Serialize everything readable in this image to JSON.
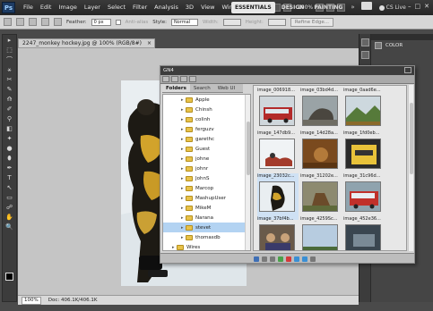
{
  "appbar": {
    "logo": "Ps",
    "menu": [
      "File",
      "Edit",
      "Image",
      "Layer",
      "Select",
      "Filter",
      "Analysis",
      "3D",
      "View",
      "Window",
      "Help"
    ],
    "zoom": "100%",
    "workspaces": [
      "ESSENTIALS",
      "DESIGN",
      "PAINTING"
    ],
    "more": "»",
    "cs_live": "CS Live",
    "window_controls": [
      "–",
      "□",
      "✕"
    ]
  },
  "options": {
    "feather_label": "Feather:",
    "feather_value": "0 px",
    "antialias_label": "Anti-alias",
    "style_label": "Style:",
    "style_value": "Normal",
    "width_label": "Width:",
    "height_label": "Height:",
    "refine_edge": "Refine Edge..."
  },
  "tools": [
    "▸",
    "⬚",
    "⌒",
    "⚹",
    "✂",
    "✎",
    "⟰",
    "✐",
    "⚲",
    "◧",
    "✦",
    "●",
    "⬮",
    "✒",
    "T",
    "↖",
    "▭",
    "☍",
    "✋",
    "🔍"
  ],
  "document": {
    "tab_title": "2247_monkey hockey.jpg @ 100% (RGB/8#)",
    "tab_close": "×",
    "status_zoom": "100%",
    "status_doc": "Doc: 406.1K/406.1K"
  },
  "right_panel": {
    "color_label": "COLOR"
  },
  "bridge": {
    "title": "GN4",
    "tabs": [
      "Folders",
      "Search",
      "Web UI"
    ],
    "folders": [
      {
        "name": "Apple",
        "indent": 2
      },
      {
        "name": "Chinsh",
        "indent": 2
      },
      {
        "name": "colinh",
        "indent": 2
      },
      {
        "name": "ferguzv",
        "indent": 2
      },
      {
        "name": "garethc",
        "indent": 2
      },
      {
        "name": "Guest",
        "indent": 2
      },
      {
        "name": "johne",
        "indent": 2
      },
      {
        "name": "johnr",
        "indent": 2
      },
      {
        "name": "JohnS",
        "indent": 2
      },
      {
        "name": "Marcop",
        "indent": 2
      },
      {
        "name": "MashupUser",
        "indent": 2
      },
      {
        "name": "MikeM",
        "indent": 2
      },
      {
        "name": "Narana",
        "indent": 2
      },
      {
        "name": "stevet",
        "indent": 2,
        "selected": true
      },
      {
        "name": "thomasdb",
        "indent": 2
      },
      {
        "name": "Wires",
        "indent": 1
      }
    ],
    "thumbnails": [
      {
        "label": "image_006918...",
        "kind": "bus"
      },
      {
        "label": "image_03bd4d...",
        "kind": "horse"
      },
      {
        "label": "image_0aad6e...",
        "kind": "mountain"
      },
      {
        "label": "image_147db9...",
        "kind": "snow"
      },
      {
        "label": "image_14d28a...",
        "kind": "brown"
      },
      {
        "label": "image_1fd0eb...",
        "kind": "yellow"
      },
      {
        "label": "image_23032c...",
        "kind": "hockey",
        "selected": true
      },
      {
        "label": "image_31202e...",
        "kind": "deer"
      },
      {
        "label": "image_31c96d...",
        "kind": "bus2"
      },
      {
        "label": "image_37bf4b...",
        "kind": "people"
      },
      {
        "label": "image_4259Sc...",
        "kind": "sky"
      },
      {
        "label": "image_452e36...",
        "kind": "dark"
      }
    ]
  },
  "colors": {
    "selection": "#b3d3f2",
    "folder": "#e8c24a",
    "dark_chrome": "#3a3a3a"
  }
}
